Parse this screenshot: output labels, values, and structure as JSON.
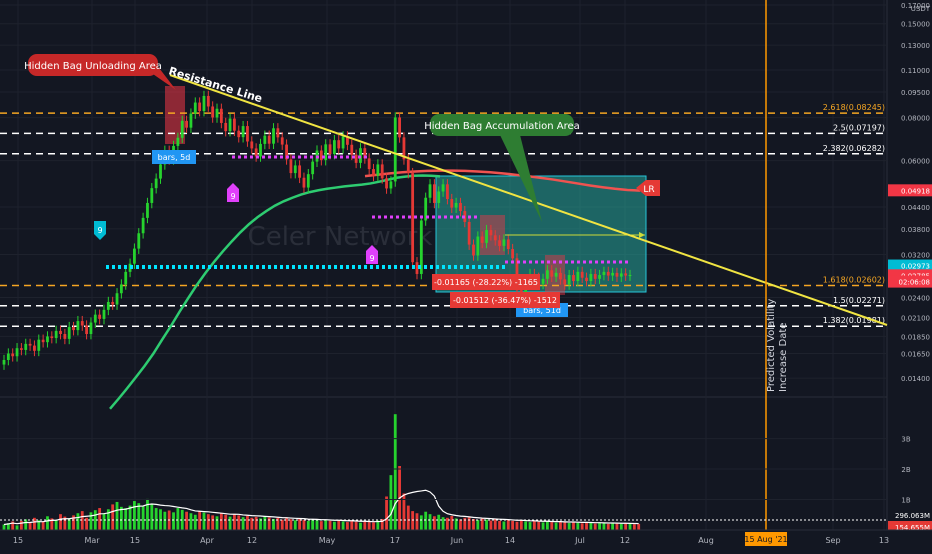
{
  "chart_data": {
    "type": "candlestick",
    "instrument_watermark": "Celer Network",
    "currency": "USDT",
    "scale": "log",
    "ylim": [
      0.0125,
      0.17
    ],
    "grid": true,
    "x_ticks": [
      "15",
      "Mar",
      "15",
      "Apr",
      "12",
      "May",
      "17",
      "Jun",
      "14",
      "Jul",
      "12",
      "Aug",
      "Sep",
      "13"
    ],
    "x_highlight_label": "15 Aug '21",
    "y_ticks": [
      {
        "value": 0.17,
        "label": "0.17000"
      },
      {
        "value": 0.15,
        "label": "0.15000"
      },
      {
        "value": 0.13,
        "label": "0.13000"
      },
      {
        "value": 0.11,
        "label": "0.11000"
      },
      {
        "value": 0.095,
        "label": "0.09500"
      },
      {
        "value": 0.08,
        "label": "0.08000"
      },
      {
        "value": 0.06,
        "label": "0.06000"
      },
      {
        "value": 0.044,
        "label": "0.04400"
      },
      {
        "value": 0.038,
        "label": "0.03800"
      },
      {
        "value": 0.032,
        "label": "0.03200"
      },
      {
        "value": 0.024,
        "label": "0.02400"
      },
      {
        "value": 0.021,
        "label": "0.02100"
      },
      {
        "value": 0.0185,
        "label": "0.01850"
      },
      {
        "value": 0.0165,
        "label": "0.01650"
      },
      {
        "value": 0.014,
        "label": "0.01400"
      }
    ],
    "price_badges": [
      {
        "label": "0.04918",
        "value": 0.04918,
        "color": "#f23645"
      },
      {
        "label": "0.02973",
        "value": 0.02973,
        "color": "#00bcd4"
      },
      {
        "label": "0.02785",
        "value": 0.02785,
        "color": "#f23645"
      },
      {
        "label": "02:06:08",
        "value": 0.0267,
        "color": "#f23645"
      }
    ],
    "fib_levels": [
      {
        "label": "2.618(0.08245)",
        "value": 0.08245,
        "color": "#f5a623"
      },
      {
        "label": "2.5(0.07197)",
        "value": 0.07197,
        "color": "#ffffff"
      },
      {
        "label": "2.382(0.06282)",
        "value": 0.06282,
        "color": "#ffffff"
      },
      {
        "label": "1.618(0.02602)",
        "value": 0.02602,
        "color": "#f5a623"
      },
      {
        "label": "1.5(0.02271)",
        "value": 0.02271,
        "color": "#ffffff"
      },
      {
        "label": "1.382(0.01981)",
        "value": 0.01981,
        "color": "#ffffff"
      }
    ],
    "annotations": {
      "unloading": "Hidden Bag Unloading Area",
      "resistance": "Resistance Line",
      "accumulation": "Hidden Bag Accumulation Area",
      "bars_box": "bars, 5d",
      "bars_box2": "bars, 51d",
      "measure1": "-0.01165 (-28.22%) -1165",
      "measure2": "-0.01512 (-36.47%) -1512",
      "lr": "LR",
      "nine1": "9",
      "nine2": "9",
      "nine3": "9",
      "predicted": "Predicted Volatility",
      "predicted2": "Increase Date"
    },
    "volume": {
      "y_ticks": [
        "3B",
        "2B",
        "1B"
      ],
      "badges": [
        "296.063M",
        "154.655M"
      ]
    },
    "series": [
      {
        "name": "price",
        "x_start": "2021-02-08",
        "step_days": 1,
        "close": [
          0.0158,
          0.0165,
          0.0162,
          0.0171,
          0.0169,
          0.0176,
          0.0174,
          0.0168,
          0.0181,
          0.0178,
          0.0185,
          0.0183,
          0.0192,
          0.0188,
          0.0182,
          0.0197,
          0.0193,
          0.0205,
          0.0199,
          0.0188,
          0.0203,
          0.0214,
          0.0208,
          0.0221,
          0.0233,
          0.0229,
          0.0247,
          0.0262,
          0.0285,
          0.0301,
          0.0333,
          0.0369,
          0.0409,
          0.0452,
          0.0499,
          0.0532,
          0.0585,
          0.0641,
          0.0605,
          0.0662,
          0.0699,
          0.0783,
          0.0748,
          0.0822,
          0.0885,
          0.0836,
          0.0925,
          0.0862,
          0.0801,
          0.0849,
          0.0772,
          0.0731,
          0.0795,
          0.0733,
          0.0702,
          0.0756,
          0.0682,
          0.0651,
          0.0617,
          0.0671,
          0.0709,
          0.0672,
          0.0745,
          0.0701,
          0.0668,
          0.0605,
          0.0552,
          0.0581,
          0.0535,
          0.0501,
          0.0548,
          0.0596,
          0.0642,
          0.0602,
          0.0669,
          0.0627,
          0.0688,
          0.0651,
          0.0706,
          0.0667,
          0.0624,
          0.0591,
          0.0652,
          0.0609,
          0.0567,
          0.0542,
          0.0585,
          0.0533,
          0.0498,
          0.0522,
          0.0801,
          0.0701,
          0.0605,
          0.0552,
          0.0304,
          0.0281,
          0.0402,
          0.0468,
          0.0512,
          0.0452,
          0.0488,
          0.0512,
          0.0464,
          0.0438,
          0.0452,
          0.0428,
          0.0398,
          0.0342,
          0.0318,
          0.0361,
          0.0346,
          0.0377,
          0.0364,
          0.0352,
          0.0339,
          0.0354,
          0.0332,
          0.0312,
          0.0252,
          0.0243,
          0.0268,
          0.0281,
          0.0274,
          0.0263,
          0.0272,
          0.0288,
          0.0276,
          0.0283,
          0.0271,
          0.0262,
          0.0279,
          0.0268,
          0.0285,
          0.0274,
          0.0268,
          0.0281,
          0.0272,
          0.0279,
          0.0285,
          0.0278,
          0.0283,
          0.0276,
          0.0282,
          0.0278,
          0.0279
        ]
      },
      {
        "name": "volume",
        "values": [
          0.18,
          0.22,
          0.28,
          0.15,
          0.3,
          0.35,
          0.25,
          0.4,
          0.32,
          0.28,
          0.45,
          0.38,
          0.31,
          0.52,
          0.44,
          0.36,
          0.48,
          0.55,
          0.62,
          0.4,
          0.58,
          0.65,
          0.72,
          0.55,
          0.68,
          0.84,
          0.92,
          0.76,
          0.72,
          0.8,
          0.95,
          0.88,
          0.78,
          1.02,
          0.86,
          0.72,
          0.68,
          0.6,
          0.64,
          0.58,
          0.72,
          0.66,
          0.6,
          0.55,
          0.5,
          0.62,
          0.57,
          0.52,
          0.48,
          0.45,
          0.56,
          0.5,
          0.44,
          0.52,
          0.48,
          0.42,
          0.46,
          0.4,
          0.43,
          0.38,
          0.45,
          0.41,
          0.36,
          0.4,
          0.34,
          0.39,
          0.35,
          0.32,
          0.38,
          0.33,
          0.3,
          0.36,
          0.32,
          0.29,
          0.34,
          0.3,
          0.27,
          0.32,
          0.28,
          0.26,
          0.3,
          0.27,
          0.24,
          0.28,
          0.26,
          0.25,
          0.31,
          0.36,
          1.1,
          1.8,
          3.8,
          2.1,
          1.2,
          0.8,
          0.62,
          0.55,
          0.48,
          0.6,
          0.52,
          0.45,
          0.5,
          0.42,
          0.4,
          0.46,
          0.38,
          0.35,
          0.4,
          0.42,
          0.36,
          0.33,
          0.38,
          0.34,
          0.31,
          0.36,
          0.3,
          0.28,
          0.34,
          0.3,
          0.27,
          0.32,
          0.28,
          0.26,
          0.3,
          0.27,
          0.25,
          0.29,
          0.26,
          0.24,
          0.27,
          0.25,
          0.23,
          0.26,
          0.24,
          0.22,
          0.25,
          0.23,
          0.21,
          0.24,
          0.22,
          0.2,
          0.23,
          0.21,
          0.2,
          0.22,
          0.21,
          0.19,
          0.2
        ]
      }
    ],
    "moving_average_green": [
      0.0114,
      0.0122,
      0.0131,
      0.0141,
      0.0152,
      0.0165,
      0.0181,
      0.0198,
      0.0218,
      0.0239,
      0.0261,
      0.0283,
      0.0305,
      0.0327,
      0.0349,
      0.0371,
      0.0392,
      0.0411,
      0.0428,
      0.0444,
      0.0457,
      0.0468,
      0.0478,
      0.0486,
      0.0492,
      0.0497,
      0.0501,
      0.0505,
      0.0508,
      0.0511,
      0.0515,
      0.0521,
      0.0528,
      0.0535,
      0.0539,
      0.0542,
      0.0543,
      0.0542,
      0.054
    ],
    "moving_average_red": [
      0.0541,
      0.0546,
      0.0551,
      0.0555,
      0.0558,
      0.056,
      0.0561,
      0.0561,
      0.056,
      0.0558,
      0.0555,
      0.0551,
      0.0546,
      0.0541,
      0.0535,
      0.0529,
      0.0522,
      0.0515,
      0.0508,
      0.0502,
      0.0497,
      0.0493,
      0.0491
    ]
  }
}
